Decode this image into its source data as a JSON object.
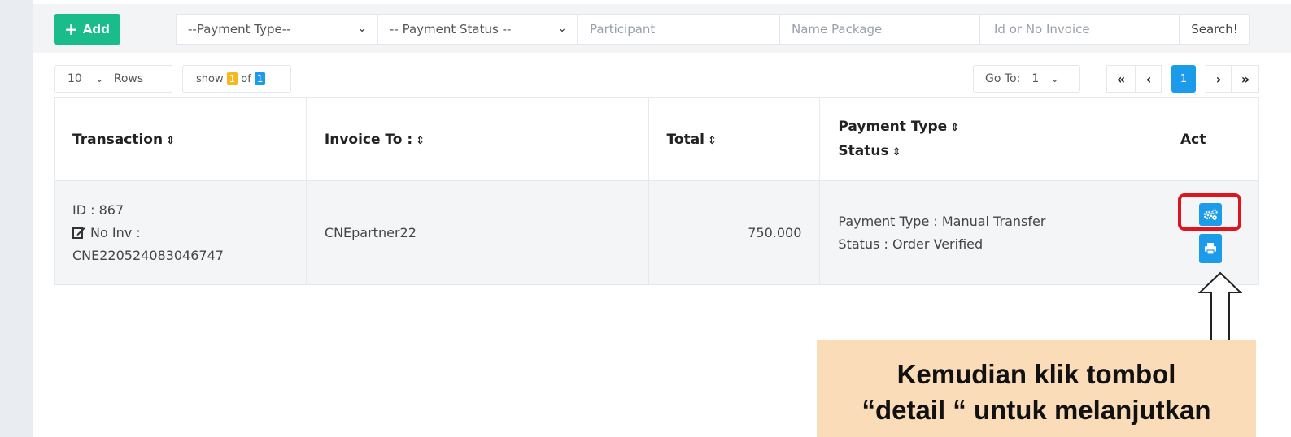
{
  "toolbar": {
    "add_label": "Add",
    "payment_type_select": "--Payment Type--",
    "payment_status_select": "-- Payment Status --",
    "participant_placeholder": "Participant",
    "name_package_placeholder": "Name Package",
    "invoice_placeholder": "Id or No Invoice",
    "search_label": "Search!"
  },
  "pagination": {
    "rows_value": "10",
    "rows_label": "Rows",
    "show_label": "show",
    "show_current": "1",
    "of_label": "of",
    "show_total": "1",
    "goto_label": "Go To:",
    "goto_value": "1",
    "first_label": "«",
    "prev_label": "‹",
    "current_page": "1",
    "next_label": "›",
    "last_label": "»"
  },
  "table": {
    "headers": {
      "transaction": "Transaction",
      "invoice_to": "Invoice To :",
      "total": "Total",
      "payment_type": "Payment Type",
      "status": "Status",
      "act": "Act"
    },
    "rows": [
      {
        "id_line": "ID : 867",
        "no_inv_label": "No Inv :",
        "invoice_no": "CNE220524083046747",
        "invoice_to": "CNEpartner22",
        "total": "750.000",
        "payment_type_line": "Payment Type : Manual Transfer",
        "status_line": "Status : Order Verified"
      }
    ]
  },
  "annotation": {
    "line1": "Kemudian klik tombol",
    "line2": "“detail “ untuk melanjutkan"
  },
  "colors": {
    "add_button": "#1abc8c",
    "primary_blue": "#1c9bea",
    "highlight_red": "#e0141e",
    "badge_yellow": "#f6b81c",
    "callout_bg": "#fbdcb8"
  }
}
